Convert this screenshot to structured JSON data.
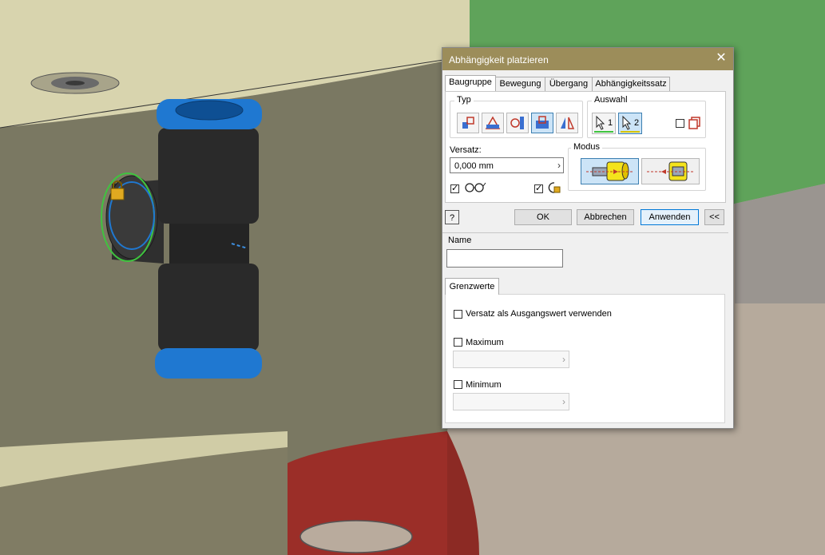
{
  "dialog": {
    "title": "Abhängigkeit platzieren",
    "close_glyph": "✕",
    "tabs": [
      "Baugruppe",
      "Bewegung",
      "Übergang",
      "Abhängigkeitssatz"
    ],
    "typ_label": "Typ",
    "auswahl_label": "Auswahl",
    "auswahl_1": "1",
    "auswahl_2": "2",
    "versatz_label": "Versatz:",
    "versatz_value": "0,000 mm",
    "modus_label": "Modus",
    "ok_label": "OK",
    "abbrechen_label": "Abbrechen",
    "anwenden_label": "Anwenden",
    "collapse_label": "<<",
    "help_glyph": "?",
    "name_label": "Name",
    "name_value": "",
    "grenzwerte_tab": "Grenzwerte",
    "versatz_ausgang_label": "Versatz als Ausgangswert verwenden",
    "maximum_label": "Maximum",
    "minimum_label": "Minimum",
    "selected_type_index": 3,
    "selected_mode_index": 0,
    "checkbox_preview": true,
    "checkbox_predict": true,
    "checkbox_auswahl": false,
    "checkbox_versatz_ausgang": false,
    "checkbox_maximum": false,
    "checkbox_minimum": false
  },
  "colors": {
    "titlebar": "#9c8d5a",
    "fitting_blue": "#1f78d1",
    "fitting_black": "#2a2a2a",
    "cylinder": "#7a7862",
    "cylinder_top": "#d8d4ae",
    "red_plate": "#9b2e28",
    "green_plate": "#5fa35a",
    "lock": "#e0a920"
  }
}
